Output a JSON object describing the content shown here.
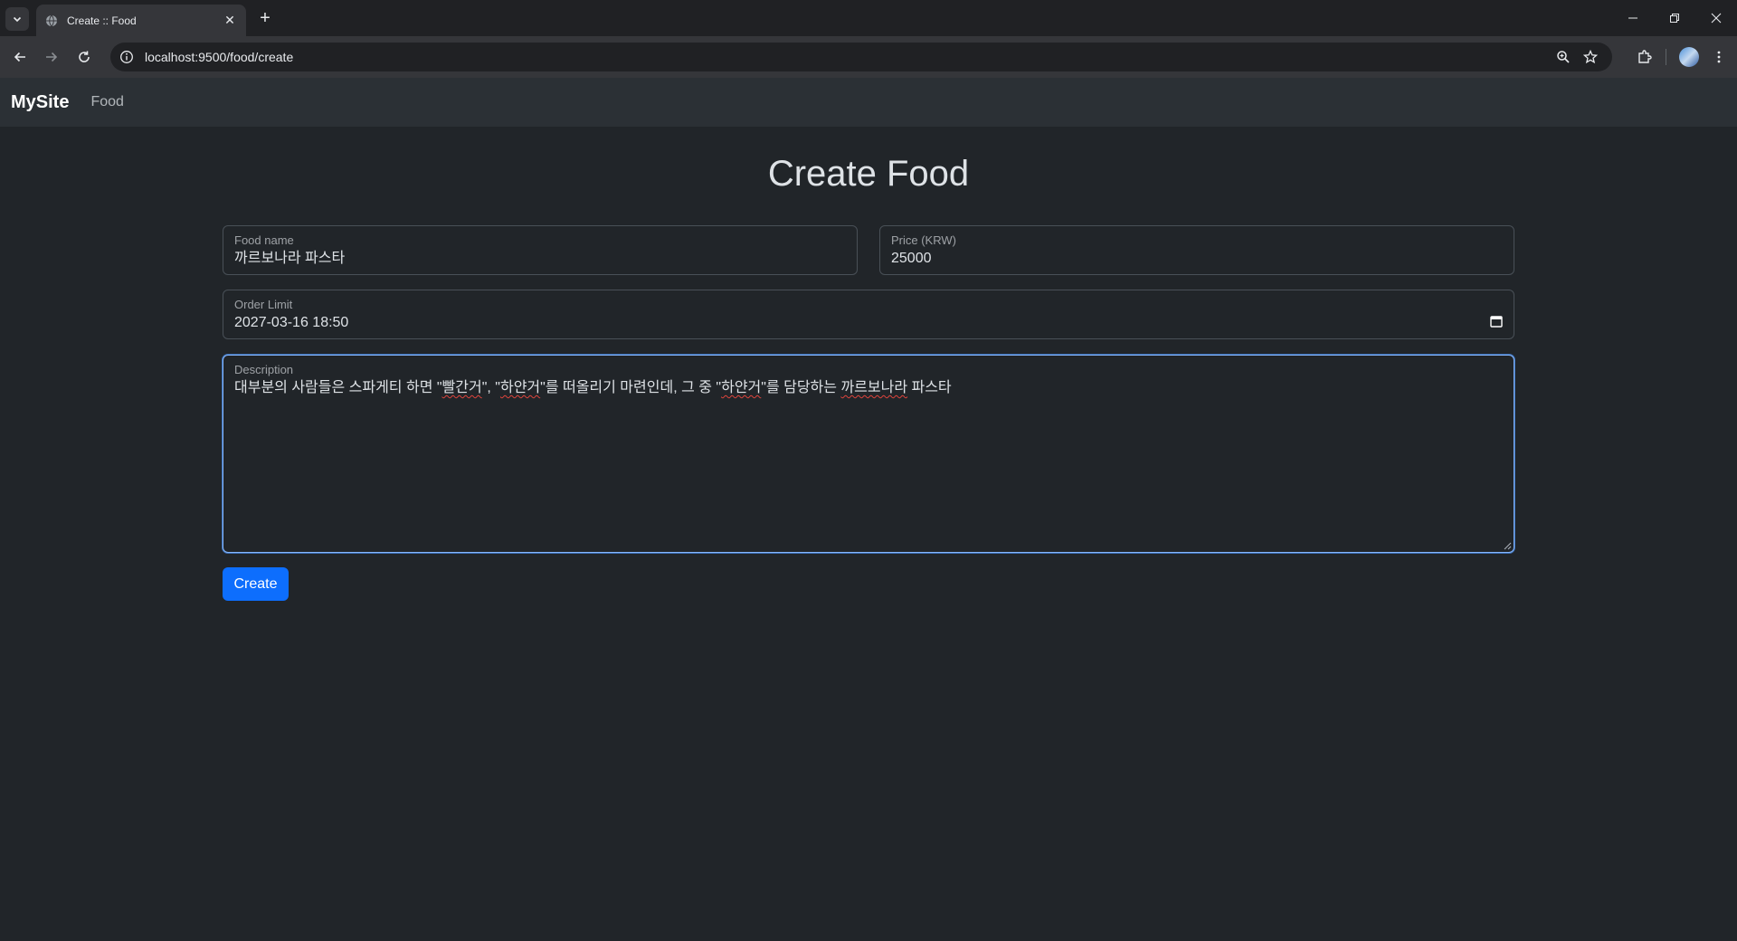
{
  "browser": {
    "tab_title": "Create :: Food",
    "url": "localhost:9500/food/create"
  },
  "navbar": {
    "brand": "MySite",
    "links": [
      "Food"
    ]
  },
  "page": {
    "title": "Create Food"
  },
  "form": {
    "food_name": {
      "label": "Food name",
      "value": "까르보나라 파스타"
    },
    "price": {
      "label": "Price (KRW)",
      "value": "25000"
    },
    "order_limit": {
      "label": "Order Limit",
      "value": "2027-03-16 18:50"
    },
    "description": {
      "label": "Description",
      "value_parts": [
        "대부분의 사람들은 스파게티 하면 \"",
        "빨간거",
        "\", \"",
        "하얀거",
        "\"를 떠올리기 마련인데, 그 중 \"",
        "하얀거",
        "\"를 담당하는 ",
        "까르보나라",
        " 파스타"
      ]
    },
    "submit_label": "Create"
  }
}
